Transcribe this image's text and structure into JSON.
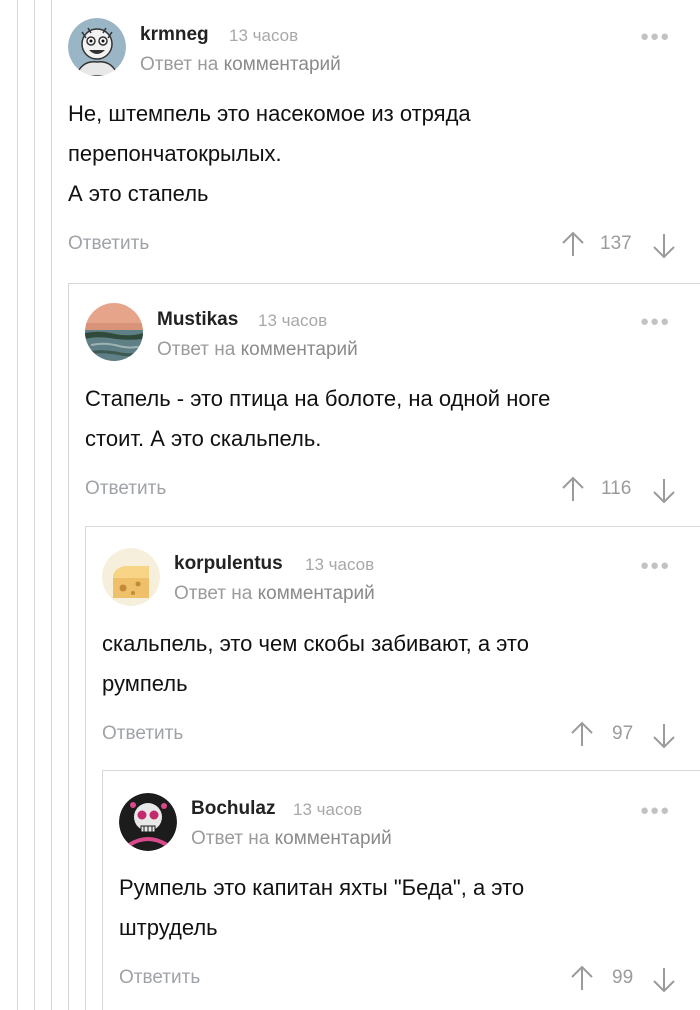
{
  "comments": [
    {
      "author": "krmneg",
      "time": "13 часов",
      "reply_prefix": "Ответ на",
      "reply_link": "комментарий",
      "more": "●●●",
      "lines": [
        "Не, штемпель это насекомое из отряда",
        "перепончатокрылых.",
        "А это стапель"
      ],
      "reply_button": "Ответить",
      "rating": "137",
      "avatar_icon": "cartoon-avatar-icon"
    },
    {
      "author": "Mustikas",
      "time": "13 часов",
      "reply_prefix": "Ответ на",
      "reply_link": "комментарий",
      "more": "●●●",
      "lines": [
        "Стапель - это птица на болоте, на одной ноге",
        "стоит. А это скальпель."
      ],
      "reply_button": "Ответить",
      "rating": "116",
      "avatar_icon": "landscape-avatar-icon"
    },
    {
      "author": "korpulentus",
      "time": "13 часов",
      "reply_prefix": "Ответ на",
      "reply_link": "комментарий",
      "more": "●●●",
      "lines": [
        "скальпель, это чем скобы забивают, а это",
        "румпель"
      ],
      "reply_button": "Ответить",
      "rating": "97",
      "avatar_icon": "cheese-avatar-icon"
    },
    {
      "author": "Bochulaz",
      "time": "13 часов",
      "reply_prefix": "Ответ на",
      "reply_link": "комментарий",
      "more": "●●●",
      "lines": [
        "Румпель это капитан яхты \"Беда\", а это",
        "штрудель"
      ],
      "reply_button": "Ответить",
      "rating": "99",
      "avatar_icon": "skull-avatar-icon"
    }
  ],
  "colors": {
    "text": "#111111",
    "meta": "#a8a8a8",
    "thread_line": "#d6d6d6"
  }
}
